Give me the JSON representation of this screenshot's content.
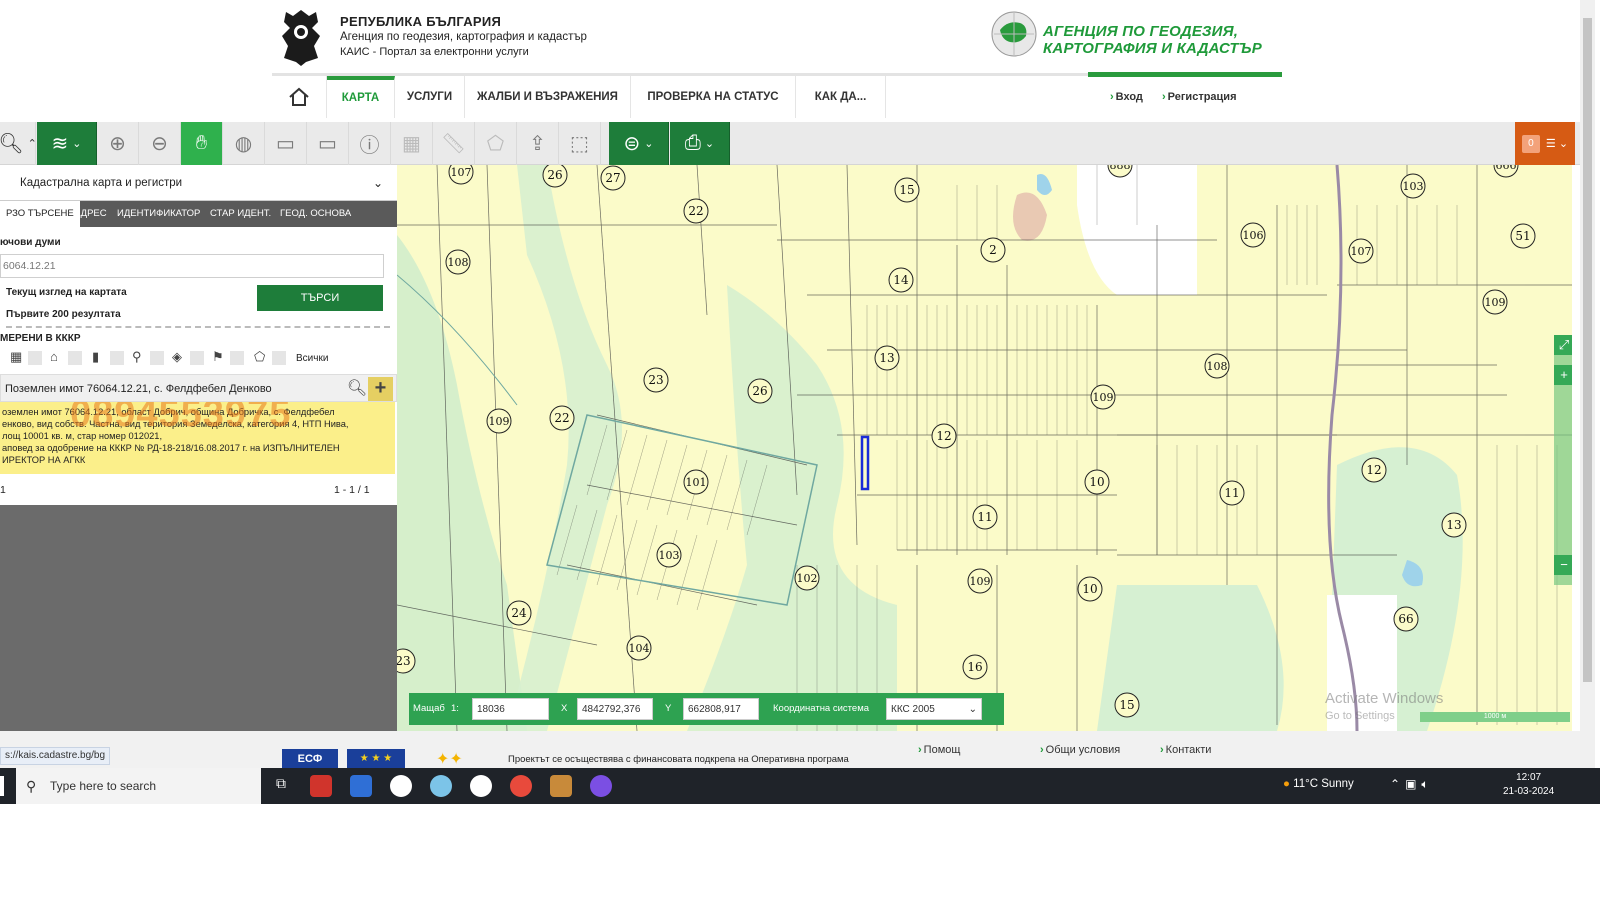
{
  "header": {
    "republic": "РЕПУБЛИКА БЪЛГАРИЯ",
    "agency_line": "Агенция по геодезия, картография и кадастър",
    "portal_line": "КАИС - Портал за електронни услуги",
    "brand_line1": "АГЕНЦИЯ ПО ГЕОДЕЗИЯ,",
    "brand_line2": "КАРТОГРАФИЯ И КАДАСТЪР",
    "accent_color": "#2a9b3d"
  },
  "nav": {
    "home_icon": "home-icon",
    "items": [
      "КАРТА",
      "УСЛУГИ",
      "ЖАЛБИ И ВЪЗРАЖЕНИЯ",
      "ПРОВЕРКА НА СТАТУС",
      "КАК ДА..."
    ],
    "login": "Вход",
    "register": "Регистрация"
  },
  "toolbar": {
    "cart_count": "0"
  },
  "left_panel": {
    "layer_select": "Кадастрална карта и регистри",
    "tabs": [
      "РЗО ТЪРСЕНЕ",
      "АДРЕС",
      "ИДЕНТИФИКАТОР",
      "СТАР ИДЕНТ.",
      "ГЕОД. ОСНОВА"
    ],
    "keywords_label": "ючови думи",
    "keywords_value": "6064.12.21",
    "option_view": "Текущ изглед на картата",
    "option_first": "Първите 200 резултата",
    "search_button": "ТЪРСИ",
    "found_label": "МЕРЕНИ В КККР",
    "all_label": "Всички",
    "result_title": "Поземлен имот 76064.12.21, с. Фелдфебел Денково",
    "result_line1": "оземлен имот 76064.12.21, област Добрич, община Добричка, с. Фелдфебел",
    "result_line2": "енково, вид собств. Частна, вид територия Земеделска, категория 4, НТП Нива,",
    "result_line3": "лощ 10001 кв. м, стар номер 012021,",
    "result_line4": "аповед за одобрение на КККР № РД-18-218/16.08.2017 г. на ИЗПЪЛНИТЕЛЕН",
    "result_line5": "ИРЕКТОР НА АГКК",
    "watermark": "0894553975",
    "pager_page": "1",
    "pager_count": "1 - 1 / 1"
  },
  "map": {
    "parcel_labels": [
      {
        "id": "lbl-107a",
        "text": "107"
      },
      {
        "id": "lbl-26a",
        "text": "26"
      },
      {
        "id": "lbl-27",
        "text": "27"
      },
      {
        "id": "lbl-22a",
        "text": "22"
      },
      {
        "id": "lbl-15",
        "text": "15"
      },
      {
        "id": "lbl-888",
        "text": "888"
      },
      {
        "id": "lbl-103a",
        "text": "103"
      },
      {
        "id": "lbl-108a",
        "text": "108"
      },
      {
        "id": "lbl-14",
        "text": "14"
      },
      {
        "id": "lbl-2",
        "text": "2"
      },
      {
        "id": "lbl-106",
        "text": "106"
      },
      {
        "id": "lbl-107b",
        "text": "107"
      },
      {
        "id": "lbl-109a",
        "text": "109"
      },
      {
        "id": "lbl-13a",
        "text": "13"
      },
      {
        "id": "lbl-23a",
        "text": "23"
      },
      {
        "id": "lbl-26b",
        "text": "26"
      },
      {
        "id": "lbl-108b",
        "text": "108"
      },
      {
        "id": "lbl-109b",
        "text": "109"
      },
      {
        "id": "lbl-22b",
        "text": "22"
      },
      {
        "id": "lbl-109c",
        "text": "109"
      },
      {
        "id": "lbl-12a",
        "text": "12"
      },
      {
        "id": "lbl-101",
        "text": "101"
      },
      {
        "id": "lbl-10a",
        "text": "10"
      },
      {
        "id": "lbl-11a",
        "text": "11"
      },
      {
        "id": "lbl-12b",
        "text": "12"
      },
      {
        "id": "lbl-11b",
        "text": "11"
      },
      {
        "id": "lbl-13b",
        "text": "13"
      },
      {
        "id": "lbl-103b",
        "text": "103"
      },
      {
        "id": "lbl-102",
        "text": "102"
      },
      {
        "id": "lbl-109d",
        "text": "109"
      },
      {
        "id": "lbl-10b",
        "text": "10"
      },
      {
        "id": "lbl-24",
        "text": "24"
      },
      {
        "id": "lbl-104",
        "text": "104"
      },
      {
        "id": "lbl-66",
        "text": "66"
      },
      {
        "id": "lbl-23b",
        "text": "23"
      },
      {
        "id": "lbl-16",
        "text": "16"
      },
      {
        "id": "lbl-15b",
        "text": "15"
      },
      {
        "id": "lbl-51",
        "text": "51"
      },
      {
        "id": "lbl-666",
        "text": "666"
      }
    ],
    "scale_label": "Мащаб",
    "scale_prefix": "1:",
    "scale_value": "18036",
    "x_label": "X",
    "x_value": "4842792,376",
    "y_label": "Y",
    "y_value": "662808,917",
    "crs_label": "Координатна система",
    "crs_value": "ККС 2005",
    "scalebar_text": "1000 м",
    "activate_line1": "Activate Windows",
    "activate_line2": "Go to Settings"
  },
  "footer": {
    "status_url": "s://kais.cadastre.bg/bg",
    "esf_logo": "ЕСФ",
    "project_text": "Проектът се осъществява с финансовата подкрепа на Оперативна програма",
    "help": "Помощ",
    "terms": "Общи условия",
    "contacts": "Контакти"
  },
  "taskbar": {
    "search_placeholder": "Type here to search",
    "weather": "11°C  Sunny",
    "time": "12:07",
    "date": "21-03-2024"
  }
}
